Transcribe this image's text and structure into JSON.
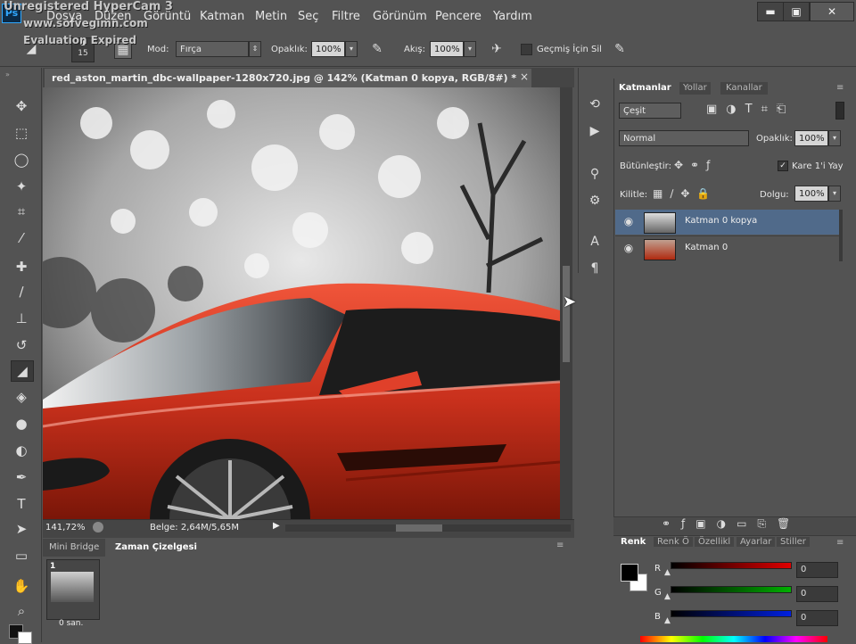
{
  "watermark": {
    "line1": "Unregistered HyperCam 3",
    "line2": "www.sofvegimn.com",
    "line3": "Evaluation Expired"
  },
  "app": {
    "logo": "Ps"
  },
  "menu": [
    "Dosya",
    "Düzen",
    "Görüntü",
    "Katman",
    "Metin",
    "Seç",
    "Filtre",
    "Görünüm",
    "Pencere",
    "Yardım"
  ],
  "window_controls": {
    "minimize": "▬",
    "restore": "▣",
    "close": "✕"
  },
  "options": {
    "brush_size": "15",
    "mode_label": "Mod:",
    "mode_value": "Fırça",
    "opacity_label": "Opaklık:",
    "opacity_value": "100%",
    "flow_label": "Akış:",
    "flow_value": "100%",
    "history_label": "Geçmiş İçin Sil"
  },
  "document": {
    "tab_title": "red_aston_martin_dbc-wallpaper-1280x720.jpg @ 142% (Katman 0 kopya, RGB/8#) *",
    "close": "×",
    "zoom": "141,72%",
    "doc_size": "Belge: 2,64M/5,65M"
  },
  "bottom_panel": {
    "tabs": [
      "Mini Bridge",
      "Zaman Çizelgesi"
    ],
    "frame_number": "1",
    "frame_duration": "0 san."
  },
  "layers_panel": {
    "tabs": [
      "Katmanlar",
      "Yollar",
      "Kanallar"
    ],
    "filter_kind": "Çeşit",
    "blend_mode": "Normal",
    "opacity_label": "Opaklık:",
    "opacity_value": "100%",
    "unify_label": "Bütünleştir:",
    "frame_propagate_label": "Kare 1'i Yay",
    "lock_label": "Kilitle:",
    "fill_label": "Dolgu:",
    "fill_value": "100%",
    "layers": [
      {
        "name": "Katman 0 kopya",
        "selected": true
      },
      {
        "name": "Katman 0",
        "selected": false
      }
    ]
  },
  "color_panel": {
    "tabs": [
      "Renk",
      "Renk Ö",
      "Özellikl",
      "Ayarlar",
      "Stiller"
    ],
    "channels": [
      {
        "label": "R",
        "value": "0",
        "color": "#e00000"
      },
      {
        "label": "G",
        "value": "0",
        "color": "#00b000"
      },
      {
        "label": "B",
        "value": "0",
        "color": "#0020e0"
      }
    ]
  },
  "colors": {
    "ui_bg": "#535353",
    "ui_dark": "#3f3f3f",
    "selection": "#506a8a",
    "car_red": "#d83a22"
  },
  "icons": {
    "tools": [
      "move-icon",
      "marquee-icon",
      "lasso-icon",
      "magic-wand-icon",
      "crop-icon",
      "eyedropper-icon",
      "healing-brush-icon",
      "brush-icon",
      "clone-stamp-icon",
      "history-brush-icon",
      "eraser-icon",
      "paint-bucket-icon",
      "blur-icon",
      "dodge-icon",
      "pen-icon",
      "type-icon",
      "path-selection-icon",
      "rectangle-icon",
      "hand-icon",
      "zoom-icon"
    ]
  }
}
